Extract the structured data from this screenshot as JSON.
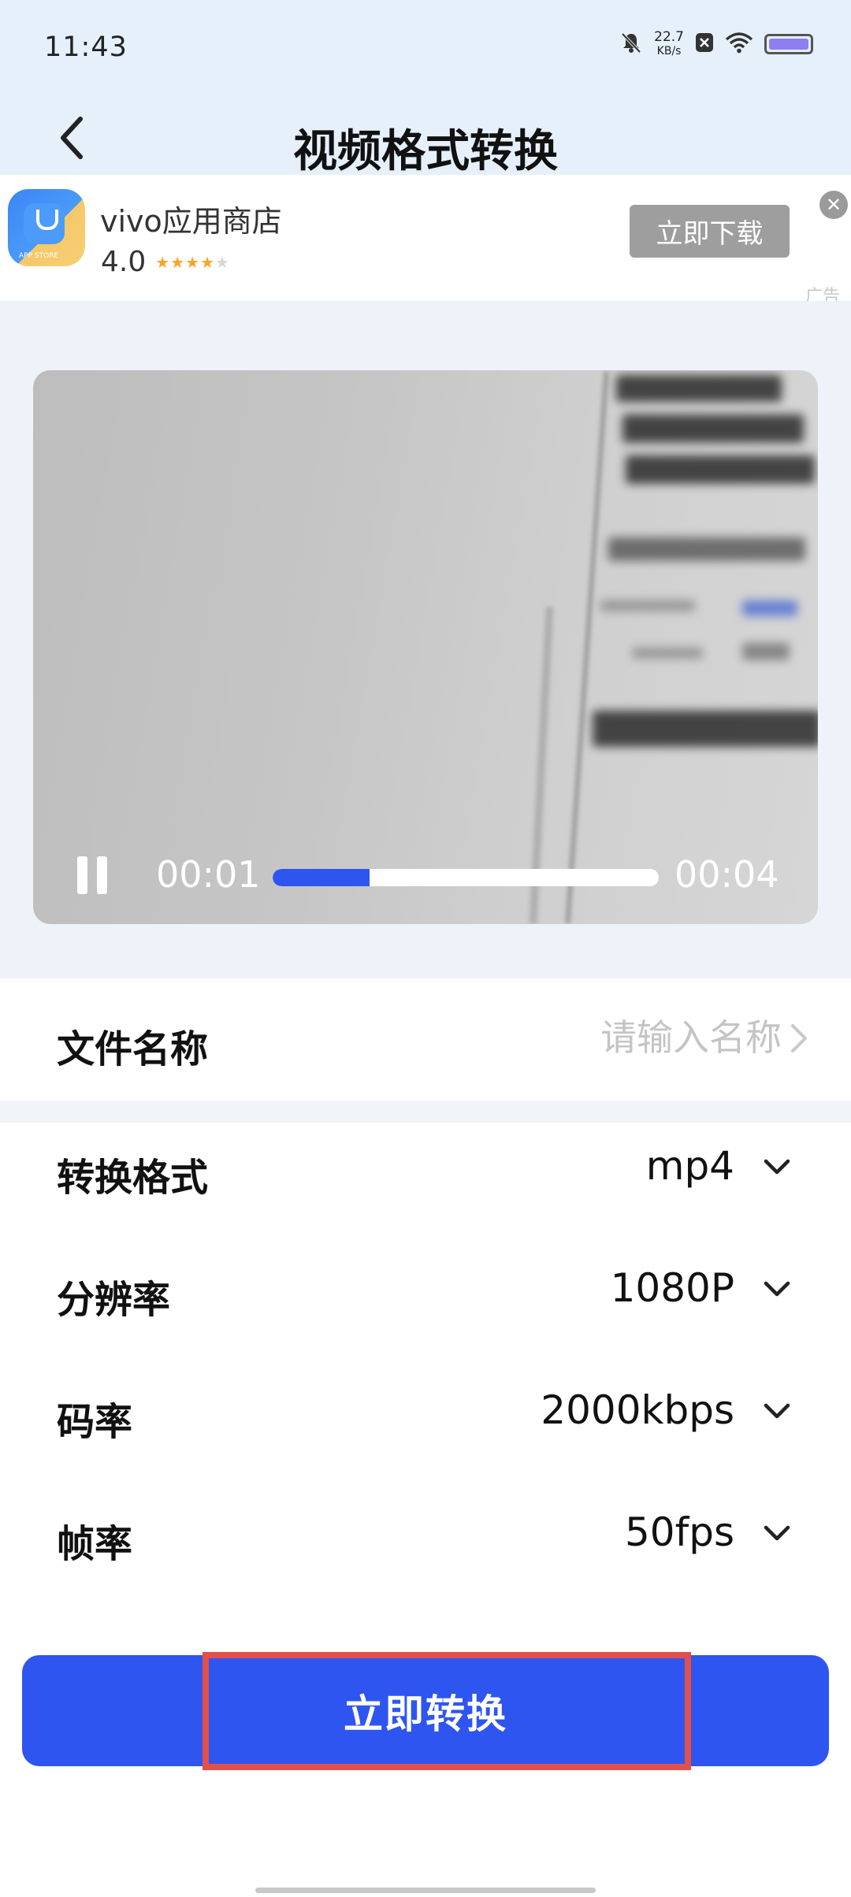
{
  "status_bar": {
    "time": "11:43",
    "speed_value": "22.7",
    "speed_unit": "KB/s",
    "icons": [
      "mute-bell-icon",
      "notification-x-icon",
      "wifi-icon",
      "battery-icon"
    ]
  },
  "header": {
    "title": "视频格式转换",
    "back_icon": "chevron-left-icon"
  },
  "ad": {
    "app_name": "vivo应用商店",
    "logo_text": "APP STORE",
    "rating": "4.0",
    "stars_filled": 4,
    "stars_total": 5,
    "download_label": "立即下载",
    "close_icon": "close-icon",
    "tag": "广告"
  },
  "video": {
    "current_time": "00:01",
    "total_time": "00:04",
    "progress_fraction": 0.25,
    "accent_color": "#2f55f0"
  },
  "file_name": {
    "label": "文件名称",
    "placeholder": "请输入名称"
  },
  "settings": {
    "format_label": "转换格式",
    "format_value": "mp4",
    "resolution_label": "分辨率",
    "resolution_value": "1080P",
    "bitrate_label": "码率",
    "bitrate_value": "2000kbps",
    "framerate_label": "帧率",
    "framerate_value": "50fps"
  },
  "convert_button": {
    "label": "立即转换",
    "color": "#2f55f0"
  },
  "highlight_color": "#e2504a"
}
